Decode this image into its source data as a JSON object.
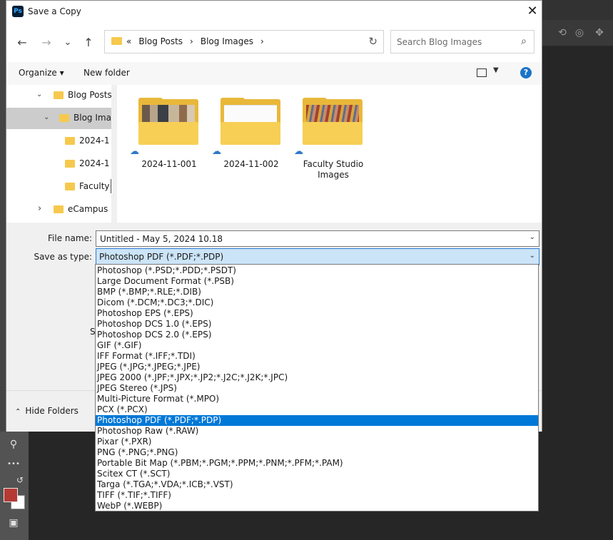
{
  "dialog": {
    "title": "Save a Copy",
    "app_icon_text": "Ps",
    "close_glyph": "✕"
  },
  "nav": {
    "back": "←",
    "forward": "→",
    "recent": "⌄",
    "up": "↑",
    "breadcrumbs": [
      "«",
      "Blog Posts",
      "›",
      "Blog Images",
      "›"
    ],
    "refresh": "↻",
    "search_placeholder": "Search Blog Images",
    "search_icon": "⌕"
  },
  "command_bar": {
    "organize": "Organize ▾",
    "new_folder": "New folder",
    "help": "?"
  },
  "nav_pane": {
    "items": [
      {
        "label": "Blog Posts",
        "chevron": "⌄",
        "selected": false
      },
      {
        "label": "Blog Ima",
        "chevron": "⌄",
        "selected": true
      },
      {
        "label": "2024-1",
        "chevron": "",
        "selected": false
      },
      {
        "label": "2024-1",
        "chevron": "",
        "selected": false
      },
      {
        "label": "Faculty",
        "chevron": "",
        "selected": false
      },
      {
        "label": "eCampus",
        "chevron": "›",
        "selected": false
      }
    ]
  },
  "folders": [
    {
      "name": "2024-11-001",
      "cloud": "☁"
    },
    {
      "name": "2024-11-002",
      "cloud": "☁"
    },
    {
      "name": "Faculty Studio Images",
      "cloud": "☁"
    }
  ],
  "form": {
    "file_name_label": "File name:",
    "file_name_value": "Untitled - May 5, 2024 10.18",
    "save_as_type_label": "Save as type:",
    "save_as_type_value": "Photoshop PDF (*.PDF;*.PDP)",
    "dropdown_caret": "⌄",
    "partial_label": "S"
  },
  "bottom": {
    "hide_folders": "Hide Folders",
    "caret": "⌃"
  },
  "file_types": [
    "Photoshop (*.PSD;*.PDD;*.PSDT)",
    "Large Document Format (*.PSB)",
    "BMP (*.BMP;*.RLE;*.DIB)",
    "Dicom (*.DCM;*.DC3;*.DIC)",
    "Photoshop EPS (*.EPS)",
    "Photoshop DCS 1.0 (*.EPS)",
    "Photoshop DCS 2.0 (*.EPS)",
    "GIF (*.GIF)",
    "IFF Format (*.IFF;*.TDI)",
    "JPEG (*.JPG;*.JPEG;*.JPE)",
    "JPEG 2000 (*.JPF;*.JPX;*.JP2;*.J2C;*.J2K;*.JPC)",
    "JPEG Stereo (*.JPS)",
    "Multi-Picture Format (*.MPO)",
    "PCX (*.PCX)",
    "Photoshop PDF (*.PDF;*.PDP)",
    "Photoshop Raw (*.RAW)",
    "Pixar (*.PXR)",
    "PNG (*.PNG;*.PNG)",
    "Portable Bit Map (*.PBM;*.PGM;*.PPM;*.PNM;*.PFM;*.PAM)",
    "Scitex CT (*.SCT)",
    "Targa (*.TGA;*.VDA;*.ICB;*.VST)",
    "TIFF (*.TIF;*.TIFF)",
    "WebP (*.WEBP)"
  ],
  "selected_file_type_index": 14,
  "ps_tools": {
    "zoom": "⚲",
    "more": "•••",
    "swap": "↺"
  },
  "colors": {
    "foreground": "#b53a34",
    "background": "#ffffff",
    "accent": "#0078d7"
  }
}
